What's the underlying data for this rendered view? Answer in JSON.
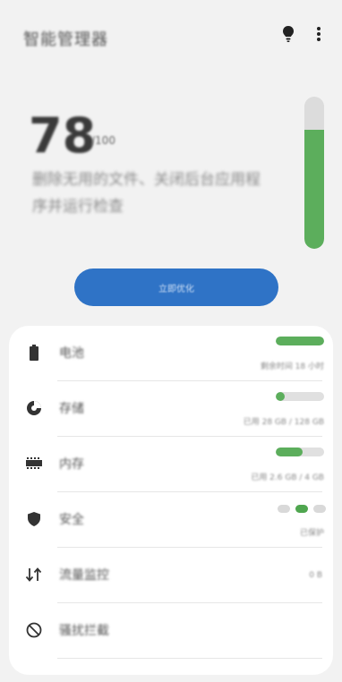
{
  "header": {
    "title": "智能管理器",
    "bulb_icon": "lightbulb-icon",
    "more_icon": "more-vert-icon"
  },
  "score": {
    "value": "78",
    "max": "/100",
    "description": "删除无用的文件、关闭后台应用程序并运行检查",
    "level": 0.78,
    "color": "#5cae5c"
  },
  "optimize_button": {
    "label": "立即优化",
    "color": "#2f73c6"
  },
  "items": [
    {
      "label": "电池",
      "icon": "battery-icon",
      "sub": "剩余时间 18 小时",
      "level": 1.0
    },
    {
      "label": "存储",
      "icon": "storage-pie-icon",
      "sub": "已用 28 GB / 128 GB",
      "level": 0.18
    },
    {
      "label": "内存",
      "icon": "memory-chip-icon",
      "sub": "已用 2.6 GB / 4 GB",
      "level": 0.55
    },
    {
      "label": "安全",
      "icon": "shield-icon",
      "sub": "已保护"
    },
    {
      "label": "流量监控",
      "icon": "data-transfer-icon",
      "sub": "0 B"
    },
    {
      "label": "骚扰拦截",
      "icon": "block-icon"
    }
  ]
}
